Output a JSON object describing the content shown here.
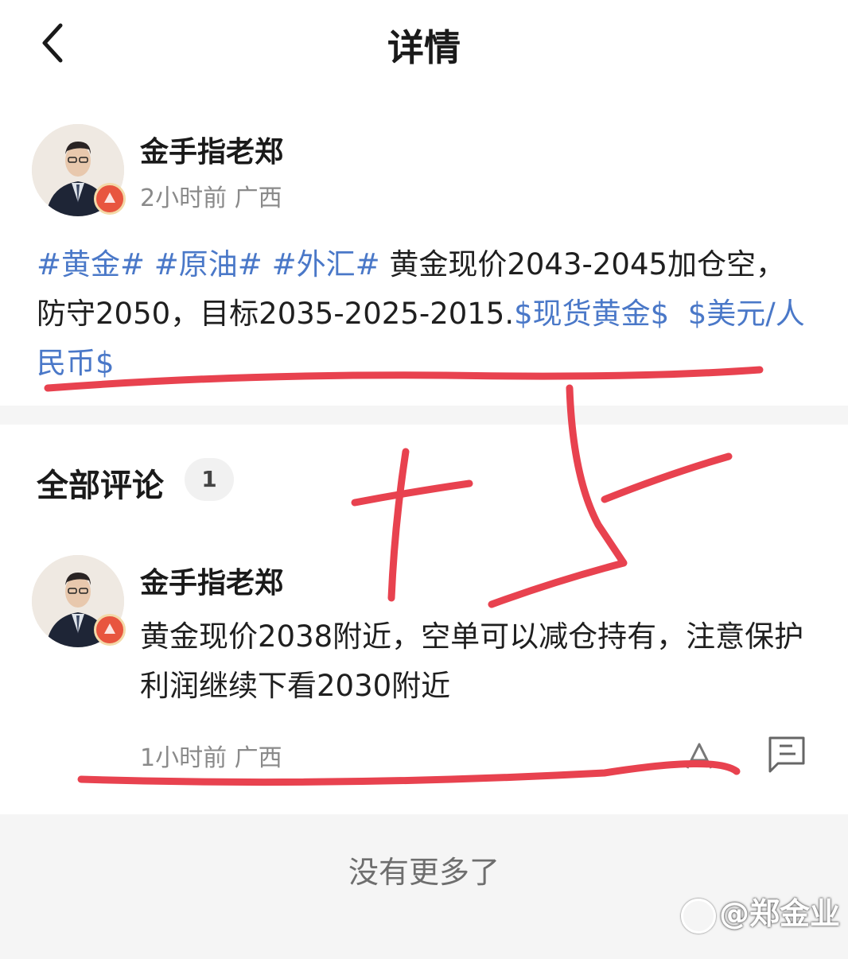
{
  "header": {
    "title": "详情",
    "back_icon": "chevron-left-icon"
  },
  "post": {
    "author": "金手指老郑",
    "meta": "2小时前 广西",
    "tags": [
      "#黄金#",
      "#原油#",
      "#外汇#"
    ],
    "text": "黄金现价2043-2045加仓空，防守2050，目标2035-2025-2015.",
    "links": [
      "$现货黄金$",
      "$美元/人民币$"
    ]
  },
  "comments": {
    "title": "全部评论",
    "count": "1",
    "items": [
      {
        "author": "金手指老郑",
        "text": "黄金现价2038附近，空单可以减仓持有，注意保护利润继续下看2030附近",
        "meta": "1小时前 广西"
      }
    ]
  },
  "footer": {
    "no_more": "没有更多了"
  },
  "watermark": {
    "text": "@郑金业"
  },
  "colors": {
    "link": "#4a78c8",
    "annotation": "#e8424f",
    "meta": "#8a8a8a"
  },
  "annotation": {
    "handwritten_text": "十下"
  }
}
